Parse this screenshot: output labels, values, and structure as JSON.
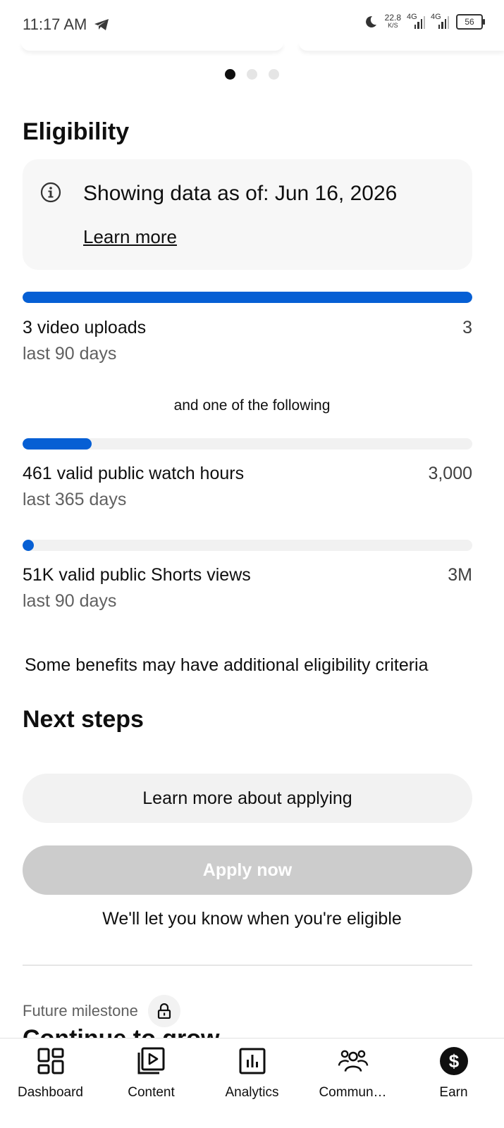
{
  "status_bar": {
    "time": "11:17 AM",
    "speed_value": "22.8",
    "speed_unit": "K/S",
    "network_1": "4G",
    "network_2": "4G",
    "battery": "56"
  },
  "carousel": {
    "page_count": 3,
    "active_index": 0
  },
  "eligibility": {
    "title": "Eligibility",
    "info_text": "Showing data as of: Jun 16, 2026",
    "learn_more": "Learn more",
    "uploads": {
      "label": "3 video uploads",
      "target": "3",
      "period": "last 90 days",
      "progress": 1.0
    },
    "or_text": "and one of the following",
    "watch_hours": {
      "label": "461 valid public watch hours",
      "target": "3,000",
      "period": "last 365 days",
      "progress": 0.154
    },
    "shorts_views": {
      "label": "51K valid public Shorts views",
      "target": "3M",
      "period": "last 90 days",
      "progress": 0.017
    },
    "benefits_note": "Some benefits may have additional eligibility criteria"
  },
  "next_steps": {
    "title": "Next steps",
    "learn_button": "Learn more about applying",
    "apply_button": "Apply now",
    "note": "We'll let you know when you're eligible"
  },
  "milestone": {
    "label": "Future milestone",
    "title": "Continue to grow"
  },
  "nav": {
    "dashboard": "Dashboard",
    "content": "Content",
    "analytics": "Analytics",
    "community": "Commun…",
    "earn": "Earn"
  },
  "colors": {
    "accent": "#065fd4",
    "track": "#f1f1f1",
    "disabled": "#cccccc"
  }
}
